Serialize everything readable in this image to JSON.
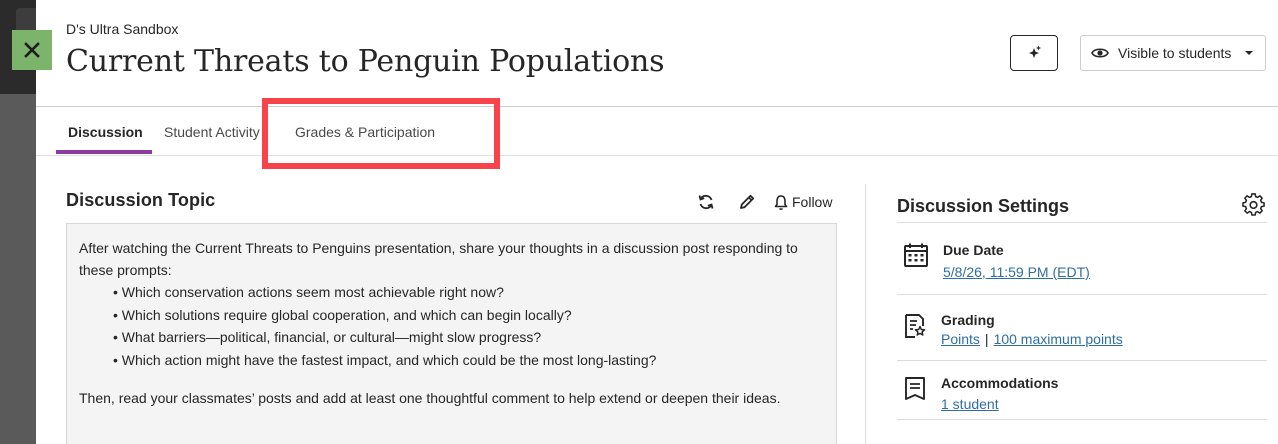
{
  "header": {
    "course_name": "D's Ultra Sandbox",
    "title": "Current Threats to Penguin Populations",
    "visibility_label": "Visible to students"
  },
  "tabs": [
    {
      "label": "Discussion"
    },
    {
      "label": "Student Activity"
    },
    {
      "label": "Grades & Participation"
    }
  ],
  "topic": {
    "heading": "Discussion Topic",
    "follow_label": "Follow",
    "intro": "After watching the Current Threats to Penguins presentation, share your thoughts in a discussion post responding to these prompts:",
    "prompts": [
      "Which conservation actions seem most achievable right now?",
      "Which solutions require global cooperation, and which can begin locally?",
      "What barriers—political, financial, or cultural—might slow progress?",
      "Which action might have the fastest impact, and which could be the most long-lasting?"
    ],
    "closing": "Then, read your classmates’ posts and add at least one thoughtful comment to help extend or deepen their ideas."
  },
  "settings": {
    "heading": "Discussion Settings",
    "due_date": {
      "label": "Due Date",
      "value": "5/8/26, 11:59 PM (EDT)"
    },
    "grading": {
      "label": "Grading",
      "type": "Points",
      "separator": "|",
      "max": "100 maximum points"
    },
    "accommodations": {
      "label": "Accommodations",
      "value": "1 student"
    }
  },
  "colors": {
    "accent_tab": "#8c3ba0",
    "highlight": "#f8434a",
    "close_button": "#7db46c",
    "link": "#2d6fa3"
  },
  "icons": [
    "close-icon",
    "sparkle-icon",
    "eye-icon",
    "caret-down-icon",
    "refresh-icon",
    "pencil-icon",
    "bell-icon",
    "gear-icon",
    "calendar-icon",
    "grading-icon",
    "accommodations-icon"
  ]
}
